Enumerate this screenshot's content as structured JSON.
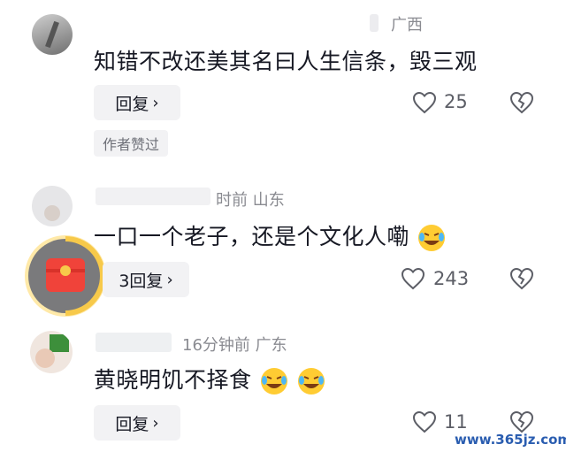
{
  "comments": [
    {
      "meta": "广西",
      "text": "知错不改还美其名曰人生信条，毁三观",
      "reply_label": "回复",
      "likes": "25",
      "author_liked": "作者赞过"
    },
    {
      "meta": "时前  山东",
      "text": "一口一个老子，还是个文化人嘞",
      "reply_label": "3回复",
      "likes": "243"
    },
    {
      "meta": "16分钟前  广东",
      "text": "黄晓明饥不择食",
      "reply_label": "回复",
      "likes": "11"
    }
  ],
  "watermark": "www.365jz.com",
  "icons": {
    "like": "heart-outline-icon",
    "dislike": "broken-heart-icon",
    "laugh": "laughing-emoji-icon",
    "redpacket": "red-packet-icon"
  },
  "colors": {
    "text": "#161823",
    "meta": "#8a8b91",
    "button_bg": "#f2f2f4",
    "redpacket_ring": "#f7c94a",
    "redpacket": "#f0433a"
  }
}
